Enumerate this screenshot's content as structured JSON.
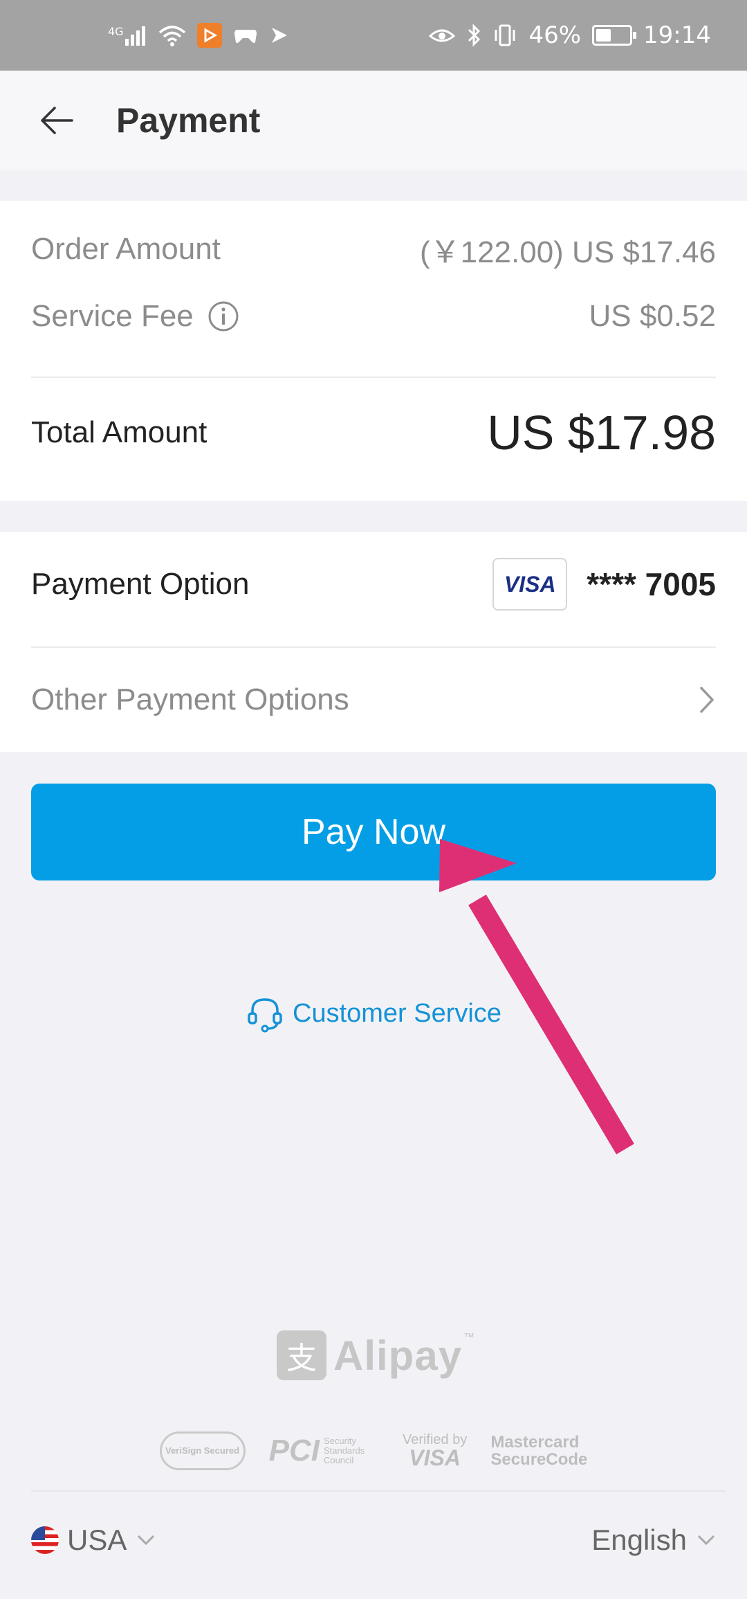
{
  "status_bar": {
    "network": "4G",
    "battery_percent": "46%",
    "battery_level": 0.46,
    "time": "19:14"
  },
  "header": {
    "title": "Payment"
  },
  "summary": {
    "order_amount_label": "Order Amount",
    "order_amount_value": "(￥122.00) US $17.46",
    "service_fee_label": "Service Fee",
    "service_fee_value": "US $0.52",
    "total_label": "Total Amount",
    "total_value": "US $17.98"
  },
  "payment": {
    "option_label": "Payment Option",
    "card_brand": "VISA",
    "card_number": "**** 7005",
    "other_options_label": "Other Payment Options"
  },
  "actions": {
    "pay_now_label": "Pay Now",
    "customer_service_label": "Customer Service"
  },
  "branding": {
    "alipay_name": "Alipay",
    "alipay_mark": "支",
    "trademark": "™",
    "security_logos": {
      "verisign": "VeriSign Secured",
      "pci": "PCI",
      "pci_sub": "Security Standards Council",
      "verified_by": "Verified by",
      "verified_visa": "VISA",
      "mastercard": "Mastercard",
      "securecode": "SecureCode"
    }
  },
  "footer": {
    "country": "USA",
    "language": "English"
  },
  "colors": {
    "primary_button": "#049ee6",
    "link": "#1592d6",
    "annotation_arrow": "#de2f74"
  },
  "icons": {
    "back": "arrow-left-icon",
    "info": "info-circle-icon",
    "chevron_right": "chevron-right-icon",
    "headset": "headset-icon",
    "chevron_down": "chevron-down-icon",
    "flag": "us-flag-icon"
  }
}
